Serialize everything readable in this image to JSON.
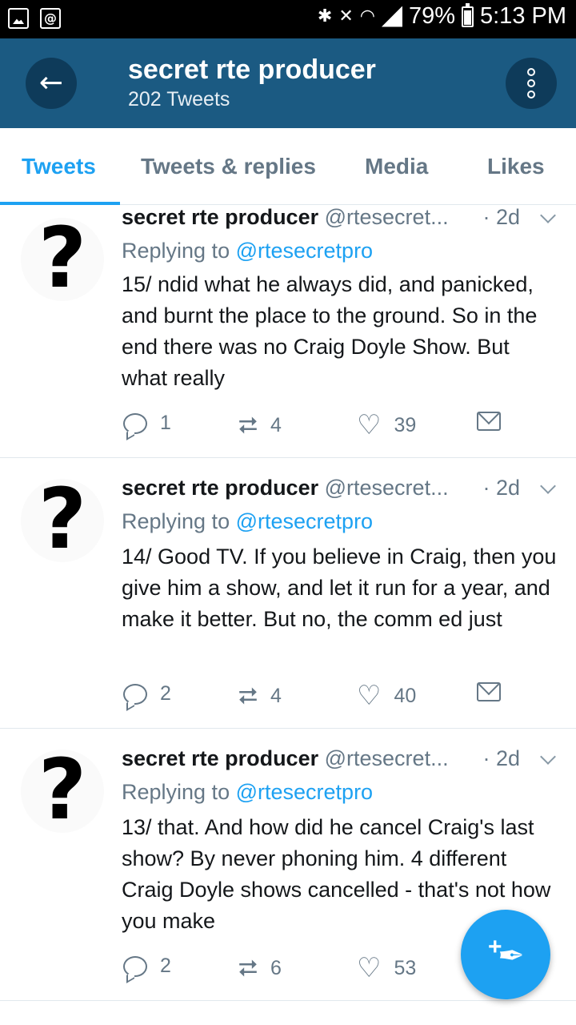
{
  "status_bar": {
    "battery": "79%",
    "time": "5:13 PM",
    "icons": [
      "gallery-icon",
      "email-notification-icon",
      "bluetooth-icon",
      "mute-icon",
      "wifi-icon",
      "signal-icon",
      "battery-icon"
    ]
  },
  "header": {
    "title": "secret rte producer",
    "subtitle": "202 Tweets",
    "back_icon": "arrow-left-icon",
    "more_icon": "more-vertical-icon"
  },
  "tabs": [
    {
      "label": "Tweets",
      "active": true
    },
    {
      "label": "Tweets & replies",
      "active": false
    },
    {
      "label": "Media",
      "active": false
    },
    {
      "label": "Likes",
      "active": false
    }
  ],
  "tweets": [
    {
      "name": "secret rte producer",
      "handle": "@rtesecret...",
      "time": "· 2d",
      "replying_prefix": "Replying to",
      "replying_to": "@rtesecretpro",
      "text": "15/ ndid what he always did, and panicked, and burnt the place to the ground. So in the end there was no Craig Doyle Show. But what really",
      "replies": "1",
      "retweets": "4",
      "likes": "39"
    },
    {
      "name": "secret rte producer",
      "handle": "@rtesecret...",
      "time": "· 2d",
      "replying_prefix": "Replying to",
      "replying_to": "@rtesecretpro",
      "text": "14/ Good TV.  If you believe in Craig, then you give him a show, and let it run for a year, and make it better. But no, the comm ed just",
      "replies": "2",
      "retweets": "4",
      "likes": "40"
    },
    {
      "name": "secret rte producer",
      "handle": "@rtesecret...",
      "time": "· 2d",
      "replying_prefix": "Replying to",
      "replying_to": "@rtesecretpro",
      "text": "13/ that. And how did he cancel Craig's last show? By never phoning him. 4 different Craig Doyle shows cancelled - that's not how you make",
      "replies": "2",
      "retweets": "6",
      "likes": "53"
    }
  ],
  "avatar_glyph": "?",
  "fab": {
    "icon": "compose-tweet-icon",
    "plus": "+"
  },
  "colors": {
    "brand": "#1da1f2",
    "appbar": "#1b5a82",
    "muted": "#657786"
  }
}
